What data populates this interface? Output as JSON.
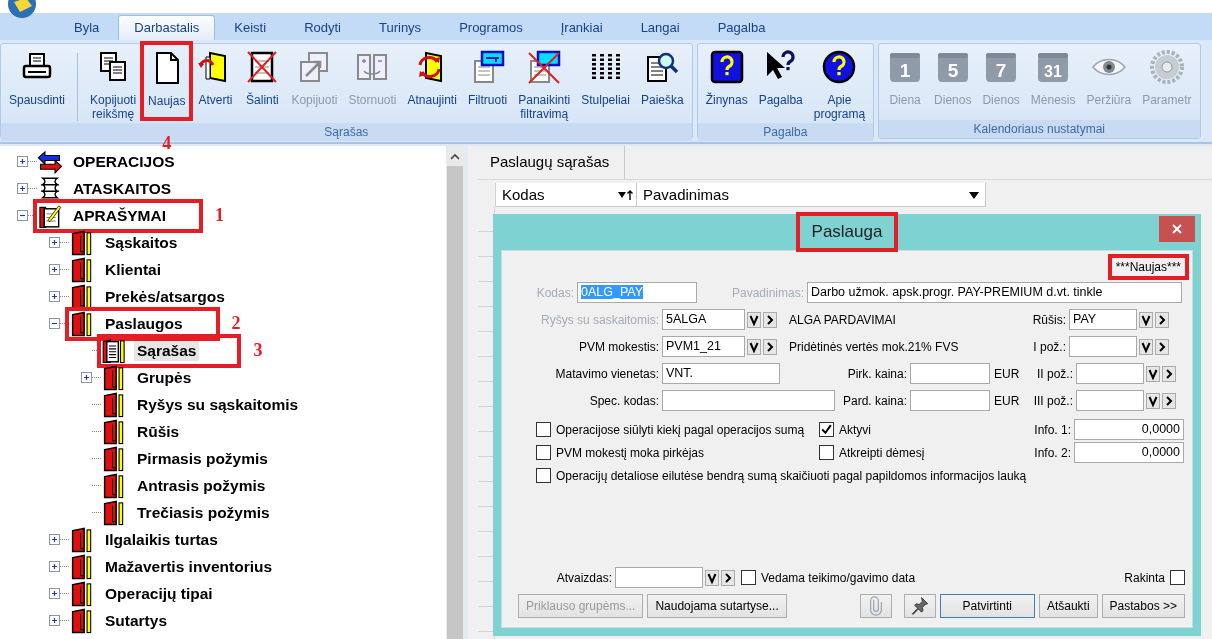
{
  "tabs": [
    {
      "label": "Byla",
      "selected": false
    },
    {
      "label": "Darbastalis",
      "selected": true
    },
    {
      "label": "Keisti",
      "selected": false
    },
    {
      "label": "Rodyti",
      "selected": false
    },
    {
      "label": "Turinys",
      "selected": false
    },
    {
      "label": "Programos",
      "selected": false
    },
    {
      "label": "Įrankiai",
      "selected": false
    },
    {
      "label": "Langai",
      "selected": false
    },
    {
      "label": "Pagalba",
      "selected": false
    }
  ],
  "ribbon": {
    "groups": [
      {
        "title": "Sąrašas",
        "buttons": [
          {
            "label": "Spausdinti",
            "kind": "printer",
            "disabled": false
          },
          {
            "label": "Kopijuoti\nreikšmę",
            "kind": "copy-doc",
            "disabled": false
          },
          {
            "label": "Naujas",
            "kind": "new-doc",
            "disabled": false,
            "annotated": true,
            "callout": "4"
          },
          {
            "label": "Atverti",
            "kind": "open",
            "disabled": false
          },
          {
            "label": "Šalinti",
            "kind": "delete",
            "disabled": false
          },
          {
            "label": "Kopijuoti",
            "kind": "copy",
            "disabled": true
          },
          {
            "label": "Stornuoti",
            "kind": "storno",
            "disabled": true
          },
          {
            "label": "Atnaujinti",
            "kind": "refresh",
            "disabled": false
          },
          {
            "label": "Filtruoti",
            "kind": "filter",
            "disabled": false
          },
          {
            "label": "Panaikinti\nfiltravimą",
            "kind": "unfilter",
            "disabled": false
          },
          {
            "label": "Stulpeliai",
            "kind": "columns",
            "disabled": false
          },
          {
            "label": "Paieška",
            "kind": "search",
            "disabled": false
          }
        ]
      },
      {
        "title": "Pagalba",
        "buttons": [
          {
            "label": "Žinynas",
            "kind": "help-box",
            "disabled": false
          },
          {
            "label": "Pagalba",
            "kind": "help-pointer",
            "disabled": false
          },
          {
            "label": "Apie\nprogramą",
            "kind": "help-circle",
            "disabled": false
          }
        ]
      },
      {
        "title": "Kalendoriaus nustatymai",
        "buttons": [
          {
            "label": "Diena",
            "kind": "calendar",
            "icon_text": "1",
            "disabled": true
          },
          {
            "label": "Dienos",
            "kind": "calendar",
            "icon_text": "5",
            "disabled": true
          },
          {
            "label": "Dienos",
            "kind": "calendar",
            "icon_text": "7",
            "disabled": true
          },
          {
            "label": "Mėnesis",
            "kind": "calendar",
            "icon_text": "31",
            "disabled": true
          },
          {
            "label": "Peržiūra",
            "kind": "eye",
            "disabled": true
          },
          {
            "label": "Parametr",
            "kind": "gear",
            "disabled": true
          }
        ]
      }
    ]
  },
  "tree": {
    "items": [
      {
        "label": "OPERACIJOS",
        "kind": "arrows",
        "expanded": false,
        "selected": false
      },
      {
        "label": "ATASKAITOS",
        "kind": "scroll",
        "expanded": false,
        "selected": false
      },
      {
        "label": "APRAŠYMAI",
        "kind": "notepad",
        "expanded": true,
        "selected": false,
        "annotated": true,
        "callout": "1",
        "children": [
          {
            "label": "Sąskaitos",
            "kind": "book",
            "expanded": false,
            "selected": false
          },
          {
            "label": "Klientai",
            "kind": "book",
            "expanded": false,
            "selected": false
          },
          {
            "label": "Prekės/atsargos",
            "kind": "book",
            "expanded": false,
            "selected": false
          },
          {
            "label": "Paslaugos",
            "kind": "book",
            "expanded": true,
            "selected": false,
            "annotated": true,
            "callout": "2",
            "children": [
              {
                "label": "Sąrašas",
                "kind": "list-book",
                "selected": true,
                "annotated": true,
                "callout": "3"
              },
              {
                "label": "Grupės",
                "kind": "book",
                "expanded": false,
                "selected": false
              },
              {
                "label": "Ryšys su sąskaitomis",
                "kind": "book",
                "selected": false
              },
              {
                "label": "Rūšis",
                "kind": "book",
                "selected": false
              },
              {
                "label": "Pirmasis požymis",
                "kind": "book",
                "selected": false
              },
              {
                "label": "Antrasis požymis",
                "kind": "book",
                "selected": false
              },
              {
                "label": "Trečiasis požymis",
                "kind": "book",
                "selected": false
              }
            ]
          },
          {
            "label": "Ilgalaikis turtas",
            "kind": "book",
            "expanded": false,
            "selected": false
          },
          {
            "label": "Mažavertis inventorius",
            "kind": "book",
            "expanded": false,
            "selected": false
          },
          {
            "label": "Operacijų tipai",
            "kind": "book",
            "expanded": false,
            "selected": false
          },
          {
            "label": "Sutartys",
            "kind": "book",
            "expanded": false,
            "selected": false
          }
        ]
      }
    ]
  },
  "list_panel": {
    "tab": "Paslaugų sąrašas",
    "columns": [
      {
        "label": "Kodas",
        "kind": "filter-sort"
      },
      {
        "label": "Pavadinimas",
        "kind": "filter"
      }
    ]
  },
  "dialog": {
    "title": "Paslauga",
    "title_annotated": true,
    "status": "***Naujas***",
    "status_annotated": true,
    "kodas": {
      "label": "Kodas:",
      "value": "0ALG_PAY",
      "label_disabled": true,
      "value_selected": true
    },
    "pavadinimas": {
      "label": "Pavadinimas:",
      "value": "Darbo užmok. apsk.progr. PAY-PREMIUM d.vt. tinkle",
      "label_disabled": true
    },
    "rysys": {
      "label": "Ryšys su saskaitomis:",
      "value": "5ALGA",
      "label_disabled": true,
      "description": "ALGA PARDAVIMAI"
    },
    "rusis": {
      "label": "Rūšis:",
      "value": "PAY"
    },
    "pvm": {
      "label": "PVM mokestis:",
      "value": "PVM1_21",
      "description": "Pridėtinės vertės mok.21% FVS"
    },
    "pozymis_1": {
      "label": "I pož.:"
    },
    "matavimo": {
      "label": "Matavimo vienetas:",
      "value": "VNT."
    },
    "pirk_kaina": {
      "label": "Pirk. kaina:",
      "currency": "EUR"
    },
    "pozymis_2": {
      "label": "II pož.:"
    },
    "spec_kodas": {
      "label": "Spec. kodas:"
    },
    "pard_kaina": {
      "label": "Pard. kaina:",
      "currency": "EUR"
    },
    "pozymis_3": {
      "label": "III pož.:"
    },
    "options": [
      {
        "label": "Operacijose siūlyti kiekį pagal operacijos sumą",
        "checked": false
      },
      {
        "label": "Aktyvi",
        "checked": true
      },
      {
        "label": "PVM mokestį moka pirkėjas",
        "checked": false
      },
      {
        "label": "Atkreipti dėmesį",
        "checked": false
      },
      {
        "label": "Operacijų detaliose eilutėse bendrą sumą skaičiuoti pagal papildomos informacijos lauką",
        "checked": false
      }
    ],
    "info_1": {
      "label": "Info. 1:",
      "value": "0,0000"
    },
    "info_2": {
      "label": "Info. 2:",
      "value": "0,0000"
    },
    "atvaizdas": {
      "label": "Atvaizdas:"
    },
    "vedama_data": {
      "label": "Vedama teikimo/gavimo data",
      "checked": false
    },
    "rakinta": {
      "label": "Rakinta",
      "checked": false
    },
    "buttons": [
      {
        "kind": "text",
        "label": "Priklauso grupėms...",
        "disabled": true,
        "default": false
      },
      {
        "kind": "text",
        "label": "Naudojama sutartyse...",
        "disabled": false,
        "default": false
      },
      {
        "kind": "paperclip",
        "disabled": true,
        "default": false
      },
      {
        "kind": "pin",
        "disabled": false,
        "default": false
      },
      {
        "kind": "text",
        "label": "Patvirtinti",
        "disabled": false,
        "default": true
      },
      {
        "kind": "text",
        "label": "Atšaukti",
        "disabled": false,
        "default": false
      },
      {
        "kind": "text",
        "label": "Pastabos >>",
        "disabled": false,
        "default": false
      }
    ]
  }
}
